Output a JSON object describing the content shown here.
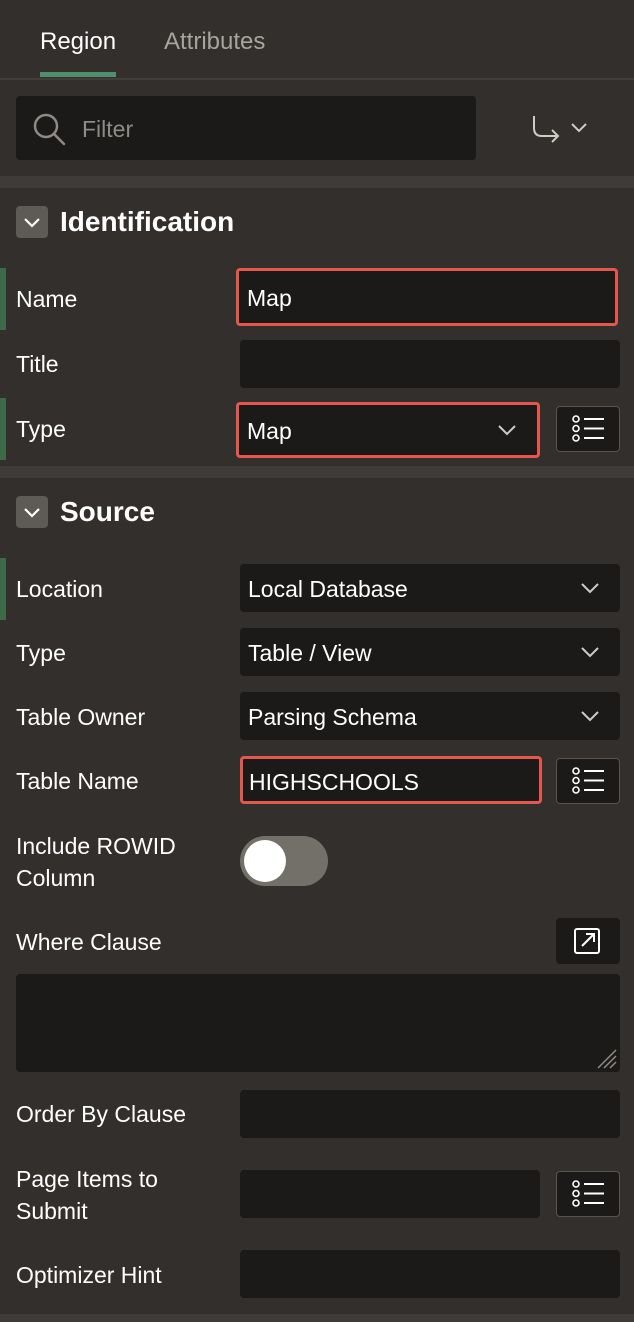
{
  "tabs": {
    "region": "Region",
    "attributes": "Attributes"
  },
  "filter": {
    "placeholder": "Filter"
  },
  "identification": {
    "title": "Identification",
    "name_label": "Name",
    "name_value": "Map",
    "title_label": "Title",
    "title_value": "",
    "type_label": "Type",
    "type_value": "Map"
  },
  "source": {
    "title": "Source",
    "location_label": "Location",
    "location_value": "Local Database",
    "type_label": "Type",
    "type_value": "Table / View",
    "table_owner_label": "Table Owner",
    "table_owner_value": "Parsing Schema",
    "table_name_label": "Table Name",
    "table_name_value": "HIGHSCHOOLS",
    "include_rowid_label_1": "Include ROWID",
    "include_rowid_label_2": "Column",
    "include_rowid_on": false,
    "where_clause_label": "Where Clause",
    "where_clause_value": "",
    "order_by_label": "Order By Clause",
    "order_by_value": "",
    "page_items_label_1": "Page Items to",
    "page_items_label_2": "Submit",
    "page_items_value": "",
    "optimizer_hint_label": "Optimizer Hint",
    "optimizer_hint_value": ""
  },
  "colors": {
    "background": "#322f2c",
    "field": "#1b1a19",
    "highlight": "#e4574d",
    "required_bar": "#3f6a4a",
    "tab_underline": "#4f8f6e"
  }
}
